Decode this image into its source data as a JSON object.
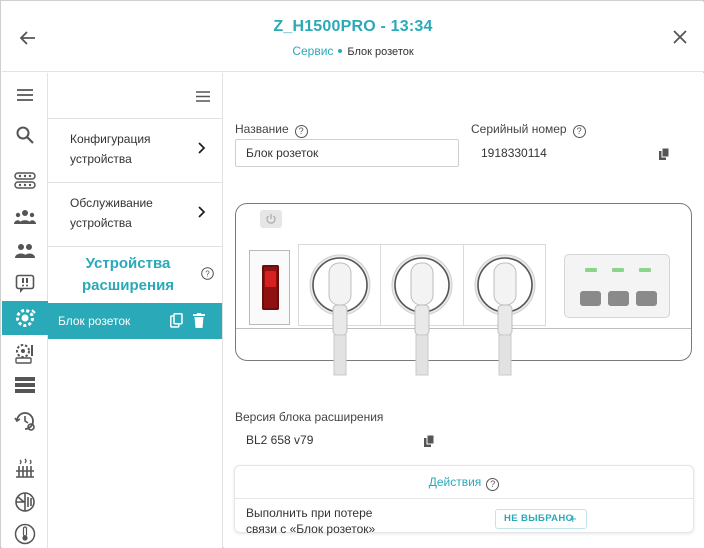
{
  "header": {
    "title": "Z_H1500PRO - 13:34",
    "breadcrumb": {
      "link": "Сервис",
      "current": "Блок розеток"
    }
  },
  "menu": {
    "items": [
      {
        "label": "Конфигурация устройства"
      },
      {
        "label": "Обслуживание устройства"
      }
    ],
    "section_title": "Устройства расширения",
    "selected_item": "Блок розеток"
  },
  "rail": {
    "icons": [
      "menu-icon",
      "search-icon",
      "sensors-icon",
      "users-icon",
      "contacts-icon",
      "events-icon",
      "gear-settings-icon",
      "control-icon",
      "list-icon",
      "service-time-icon",
      "heating-icon",
      "circuits-icon",
      "thermometer-icon"
    ]
  },
  "form": {
    "name_label": "Название",
    "name_value": "Блок розеток",
    "serial_label": "Серийный номер",
    "serial_value": "1918330114",
    "version_label": "Версия блока расширения",
    "version_value": "BL2 658 v79"
  },
  "actions": {
    "title": "Действия",
    "row_text": "Выполнить при потере связи с «Блок розеток»",
    "button_label": "НЕ ВЫБРАНО"
  },
  "colors": {
    "accent": "#2aa9b8",
    "switch_red": "#d62121",
    "led_green": "#8bd48b"
  }
}
